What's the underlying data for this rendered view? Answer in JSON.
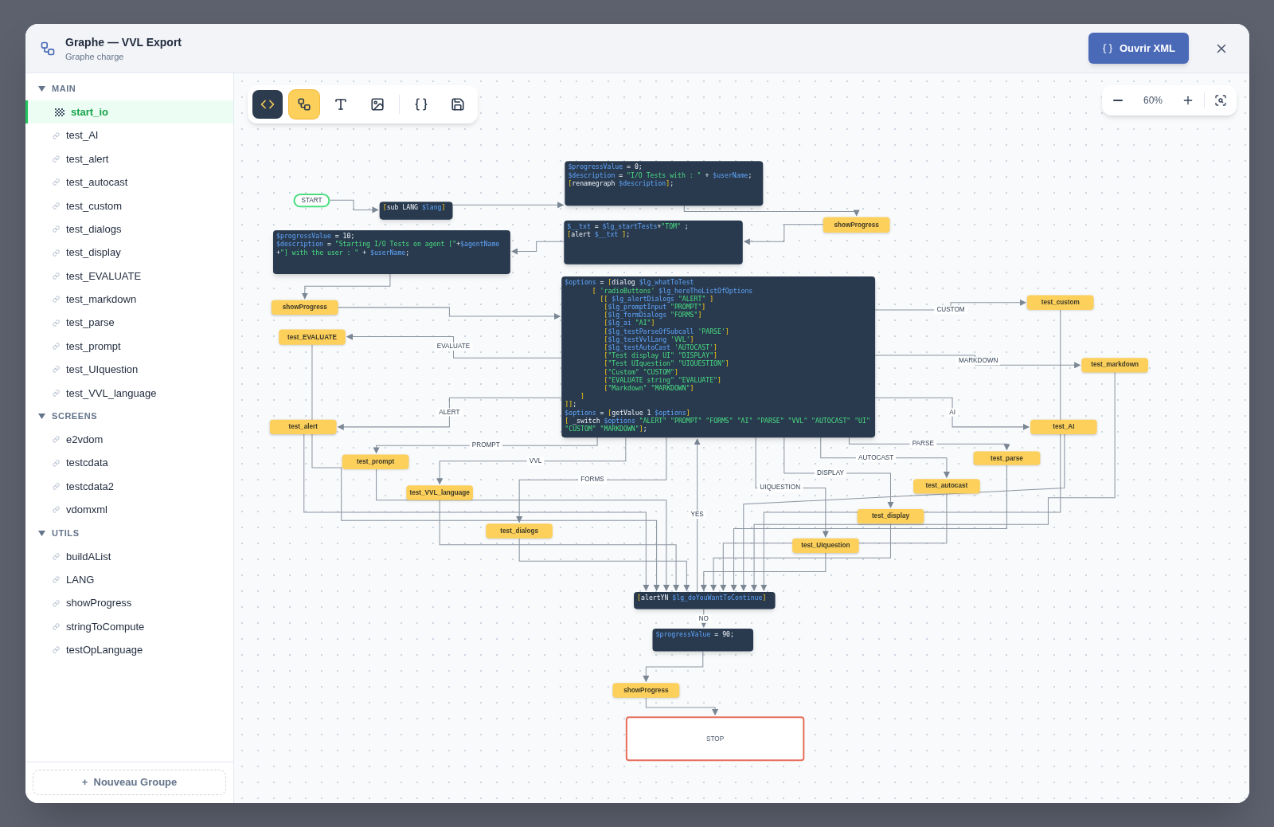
{
  "dialog": {
    "title": "Graphe — VVL Export",
    "subtitle": "Graphe charge",
    "open_xml_button": "Ouvrir XML"
  },
  "sidebar": {
    "groups": [
      {
        "title": "MAIN",
        "expanded": true,
        "items": [
          {
            "label": "start_io",
            "kind": "start",
            "selected": true
          },
          {
            "label": "test_AI",
            "kind": "graph",
            "selected": false
          },
          {
            "label": "test_alert",
            "kind": "graph",
            "selected": false
          },
          {
            "label": "test_autocast",
            "kind": "graph",
            "selected": false
          },
          {
            "label": "test_custom",
            "kind": "graph",
            "selected": false
          },
          {
            "label": "test_dialogs",
            "kind": "graph",
            "selected": false
          },
          {
            "label": "test_display",
            "kind": "graph",
            "selected": false
          },
          {
            "label": "test_EVALUATE",
            "kind": "graph",
            "selected": false
          },
          {
            "label": "test_markdown",
            "kind": "graph",
            "selected": false
          },
          {
            "label": "test_parse",
            "kind": "graph",
            "selected": false
          },
          {
            "label": "test_prompt",
            "kind": "graph",
            "selected": false
          },
          {
            "label": "test_UIquestion",
            "kind": "graph",
            "selected": false
          },
          {
            "label": "test_VVL_language",
            "kind": "graph",
            "selected": false
          }
        ]
      },
      {
        "title": "SCREENS",
        "expanded": true,
        "items": [
          {
            "label": "e2vdom",
            "kind": "graph",
            "selected": false
          },
          {
            "label": "testcdata",
            "kind": "graph",
            "selected": false
          },
          {
            "label": "testcdata2",
            "kind": "graph",
            "selected": false
          },
          {
            "label": "vdomxml",
            "kind": "graph",
            "selected": false
          }
        ]
      },
      {
        "title": "UTILS",
        "expanded": true,
        "items": [
          {
            "label": "buildAList",
            "kind": "graph",
            "selected": false
          },
          {
            "label": "LANG",
            "kind": "graph",
            "selected": false
          },
          {
            "label": "showProgress",
            "kind": "graph",
            "selected": false
          },
          {
            "label": "stringToCompute",
            "kind": "graph",
            "selected": false
          },
          {
            "label": "testOpLanguage",
            "kind": "graph",
            "selected": false
          }
        ]
      }
    ],
    "new_group_button": "+  Nouveau Groupe"
  },
  "toolbar": [
    {
      "kind": "code",
      "selected": false
    },
    {
      "kind": "graph",
      "selected": true
    },
    {
      "kind": "text",
      "selected": false
    },
    {
      "kind": "image",
      "selected": false
    },
    {
      "kind": "braces",
      "selected": false
    },
    {
      "kind": "save",
      "selected": false
    }
  ],
  "zoom": {
    "value": "60%"
  },
  "nodes": [
    {
      "kind": "start",
      "text": "START"
    },
    {
      "kind": "code",
      "lines": [
        "[sub LANG $lang]"
      ]
    },
    {
      "kind": "code",
      "lines": [
        "$progressValue = 0;",
        "$description = \"I/O Tests with : \" + $userName;",
        "[renamegraph $description];"
      ]
    },
    {
      "kind": "code",
      "lines": [
        "$__txt = $lg_startTests+\"TOM\" ;",
        "[alert $__txt ];"
      ]
    },
    {
      "kind": "action",
      "text": "showProgress"
    },
    {
      "kind": "code",
      "lines": [
        "$progressValue = 10;",
        "$description = \"Starting I/O Tests on agent [\"+$agentName",
        "+\"] with the user : \" + $userName;"
      ]
    },
    {
      "kind": "action",
      "text": "showProgress"
    },
    {
      "kind": "code",
      "lines": [
        "$options = [dialog $lg_whatToTest",
        "       [ 'radioButtons' $lg_hereTheListOfOptions",
        "         [[ $lg_alertDialogs \"ALERT\" ]",
        "          [$lg_promptInput \"PROMPT\"]",
        "          [$lg_formDialogs \"FORMS\"]",
        "          [$lg_ai \"AI\"]",
        "          [$lg_testParseOfSubcall 'PARSE']",
        "          [$lg_testVvlLang 'VVL']",
        "          [$lg_testAutoCast 'AUTOCAST']",
        "          [\"Test display UI\" \"DISPLAY\"]",
        "          [\"Test UIquestion\" \"UIQUESTION\"]",
        "          [\"Custom\" \"CUSTOM\"]",
        "          [\"EVALUATE string\" \"EVALUATE\"]",
        "          [\"Markdown\" \"MARKDOWN\"]",
        "    ]",
        "]];",
        "$options = [getValue 1 $options]",
        "[ _switch $options \"ALERT\" \"PROMPT\" \"FORMS\" \"AI\" \"PARSE\" \"VVL\" \"AUTOCAST\" \"UI\" \"CUSTOM\" \"MARKDOWN\"];"
      ]
    },
    {
      "kind": "action",
      "text": "test_EVALUATE"
    },
    {
      "kind": "action",
      "text": "test_custom"
    },
    {
      "kind": "action",
      "text": "test_markdown"
    },
    {
      "kind": "action",
      "text": "test_alert"
    },
    {
      "kind": "action",
      "text": "test_AI"
    },
    {
      "kind": "action",
      "text": "test_prompt"
    },
    {
      "kind": "action",
      "text": "test_parse"
    },
    {
      "kind": "action",
      "text": "test_VVL_language"
    },
    {
      "kind": "action",
      "text": "test_autocast"
    },
    {
      "kind": "action",
      "text": "test_dialogs"
    },
    {
      "kind": "action",
      "text": "test_display"
    },
    {
      "kind": "action",
      "text": "test_UIquestion"
    },
    {
      "kind": "code",
      "lines": [
        "[alertYN $lg_doYouWantToContinue]"
      ]
    },
    {
      "kind": "code",
      "lines": [
        "$progressValue = 90;"
      ]
    },
    {
      "kind": "action",
      "text": "showProgress"
    },
    {
      "kind": "stop",
      "text": "STOP"
    }
  ],
  "edge_labels": [
    "CUSTOM",
    "MARKDOWN",
    "AI",
    "PARSE",
    "AUTOCAST",
    "DISPLAY",
    "UIQUESTION",
    "EVALUATE",
    "ALERT",
    "PROMPT",
    "VVL",
    "FORMS",
    "YES",
    "NO"
  ]
}
